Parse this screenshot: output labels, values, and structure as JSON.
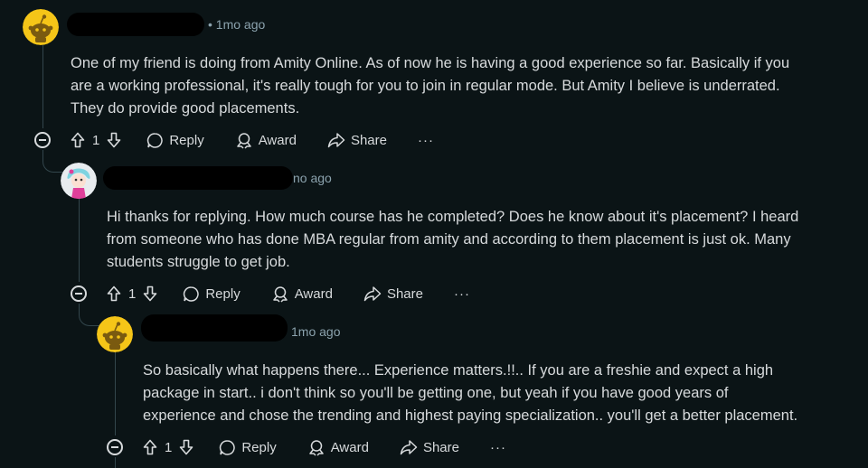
{
  "comments": [
    {
      "time": "1mo ago",
      "lines": [
        "One of my friend is doing from Amity Online. As of now he is having a good experience so far. Basically if you",
        "are a working professional, it's really tough for you to join in regular mode. But Amity I believe is underrated.",
        "They do provide good placements."
      ],
      "votes": "1",
      "reply_label": "Reply",
      "award_label": "Award",
      "share_label": "Share",
      "more_label": "···"
    },
    {
      "time": "no ago",
      "lines": [
        "Hi thanks for replying. How much course has he completed? Does he know about it's placement? I heard",
        "from someone who has done MBA regular from amity and according to them placement is just ok. Many",
        "students struggle to get job."
      ],
      "votes": "1",
      "reply_label": "Reply",
      "award_label": "Award",
      "share_label": "Share",
      "more_label": "···"
    },
    {
      "time": "1mo ago",
      "lines": [
        "So basically what happens there... Experience matters.!!.. If you are a freshie and expect a high",
        "package in start.. i don't think so you'll be getting one, but yeah if you have good years of",
        "experience and chose the trending and highest paying specialization.. you'll get a better placement."
      ],
      "votes": "1",
      "reply_label": "Reply",
      "award_label": "Award",
      "share_label": "Share",
      "more_label": "···"
    }
  ],
  "icons": {
    "upvote": "arrow-up-icon",
    "downvote": "arrow-down-icon",
    "reply": "speech-bubble-icon",
    "award": "award-icon",
    "share": "share-arrow-icon",
    "collapse": "minus-circle-icon"
  },
  "colors": {
    "background": "#0b1416",
    "text": "#d7dadc",
    "meta": "#8ba2ad",
    "avatar_yellow": "#f5c518",
    "thread_line": "#33464c"
  }
}
